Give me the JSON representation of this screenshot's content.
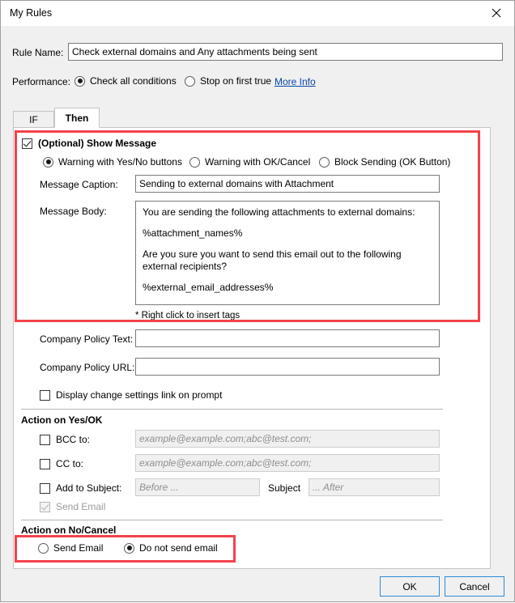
{
  "window": {
    "title": "My Rules",
    "close_icon": "close-icon"
  },
  "form": {
    "rule_name_label": "Rule Name:",
    "rule_name_value": "Check external domains and Any attachments being sent",
    "performance_label": "Performance:",
    "performance_options": [
      {
        "label": "Check all conditions",
        "selected": true
      },
      {
        "label": "Stop on first true",
        "selected": false
      }
    ],
    "more_info_link": "More Info"
  },
  "tabs": [
    {
      "label": "IF",
      "active": false
    },
    {
      "label": "Then",
      "active": true
    }
  ],
  "then_tab": {
    "show_message": {
      "checkbox_label": "(Optional) Show Message",
      "checked": true,
      "prompt_options": [
        {
          "label": "Warning with Yes/No buttons",
          "selected": true
        },
        {
          "label": "Warning with OK/Cancel",
          "selected": false
        },
        {
          "label": "Block Sending (OK Button)",
          "selected": false
        }
      ],
      "caption_label": "Message Caption:",
      "caption_value": "Sending to external domains with Attachment",
      "body_label": "Message Body:",
      "body_lines": [
        "You are sending the following attachments to external domains:",
        "%attachment_names%",
        "Are you sure you want to send this email out to the following external recipients?",
        "%external_email_addresses%"
      ],
      "hint": "* Right click to insert tags"
    },
    "policy": {
      "text_label": "Company Policy Text:",
      "text_value": "",
      "url_label": "Company Policy URL:",
      "url_value": "",
      "display_link_label": "Display change settings link on prompt",
      "display_link_checked": false
    },
    "action_yes_ok": {
      "title": "Action on Yes/OK",
      "bcc_label": "BCC to:",
      "bcc_checked": false,
      "bcc_placeholder": "example@example.com;abc@test.com;",
      "bcc_value": "",
      "cc_label": "CC to:",
      "cc_checked": false,
      "cc_placeholder": "example@example.com;abc@test.com;",
      "cc_value": "",
      "subject_label": "Add to Subject:",
      "subject_checked": false,
      "subject_before_placeholder": "Before ...",
      "subject_before_value": "",
      "subject_middle_label": "Subject",
      "subject_after_placeholder": "... After",
      "subject_after_value": "",
      "send_email_label": "Send Email",
      "send_email_checked": true,
      "send_email_disabled": true
    },
    "action_no_cancel": {
      "title": "Action on No/Cancel",
      "options": [
        {
          "label": "Send Email",
          "selected": false
        },
        {
          "label": "Do not send email",
          "selected": true
        }
      ]
    }
  },
  "footer": {
    "ok_label": "OK",
    "cancel_label": "Cancel"
  },
  "colors": {
    "highlight": "#f4424a",
    "link": "#0645ad",
    "button_border": "#2e8ad8"
  }
}
